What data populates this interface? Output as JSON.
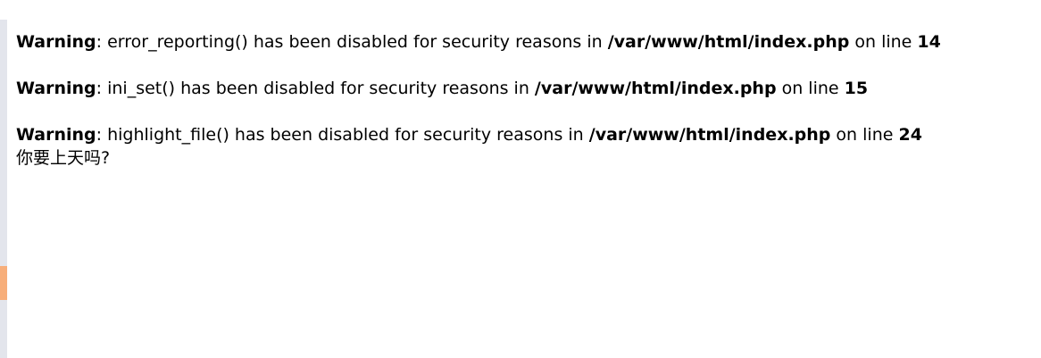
{
  "colors": {
    "background": "#ffffff",
    "text": "#000000",
    "edge_strip": "#e3e5ec",
    "edge_accent": "#f7ae7a"
  },
  "warnings": [
    {
      "label": "Warning",
      "separator": ": ",
      "message": "error_reporting() has been disabled for security reasons in ",
      "file": "/var/www/html/index.php",
      "line_text": " on line ",
      "line": "14"
    },
    {
      "label": "Warning",
      "separator": ": ",
      "message": "ini_set() has been disabled for security reasons in ",
      "file": "/var/www/html/index.php",
      "line_text": " on line ",
      "line": "15"
    },
    {
      "label": "Warning",
      "separator": ": ",
      "message": "highlight_file() has been disabled for security reasons in ",
      "file": "/var/www/html/index.php",
      "line_text": " on line ",
      "line": "24"
    }
  ],
  "output": "你要上天吗?"
}
